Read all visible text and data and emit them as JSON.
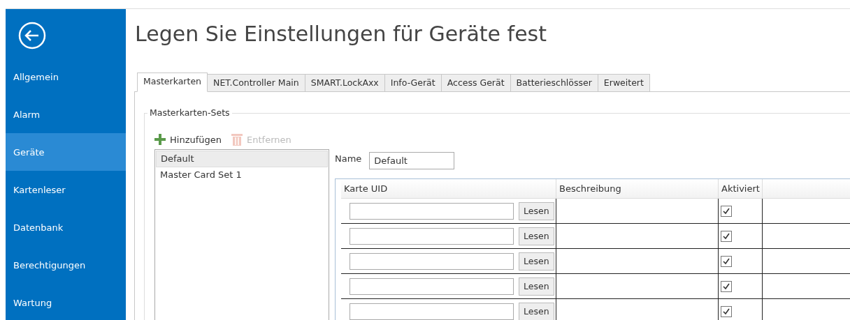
{
  "sidebar": {
    "items": [
      {
        "label": "Allgemein",
        "selected": false
      },
      {
        "label": "Alarm",
        "selected": false
      },
      {
        "label": "Geräte",
        "selected": true
      },
      {
        "label": "Kartenleser",
        "selected": false
      },
      {
        "label": "Datenbank",
        "selected": false
      },
      {
        "label": "Berechtigungen",
        "selected": false
      },
      {
        "label": "Wartung",
        "selected": false
      }
    ]
  },
  "title": "Legen Sie Einstellungen für Geräte fest",
  "tabs": [
    {
      "label": "Masterkarten",
      "selected": true
    },
    {
      "label": "NET.Controller Main",
      "selected": false
    },
    {
      "label": "SMART.LockAxx",
      "selected": false
    },
    {
      "label": "Info-Gerät",
      "selected": false
    },
    {
      "label": "Access Gerät",
      "selected": false
    },
    {
      "label": "Batterieschlösser",
      "selected": false
    },
    {
      "label": "Erweitert",
      "selected": false
    }
  ],
  "group_title": "Masterkarten-Sets",
  "toolbar": [
    {
      "label": "Hinzufügen",
      "kind": "add",
      "disabled": false
    },
    {
      "label": "Entfernen",
      "kind": "remove",
      "disabled": true
    }
  ],
  "sets": [
    {
      "label": "Default",
      "selected": true
    },
    {
      "label": "Master Card Set 1",
      "selected": false
    }
  ],
  "name_field": {
    "label": "Name",
    "value": "Default"
  },
  "grid": {
    "columns": [
      "Karte UID",
      "Beschreibung",
      "Aktiviert"
    ],
    "rows": [
      {
        "button": "Lesen",
        "checked": true
      },
      {
        "button": "Lesen",
        "checked": true
      },
      {
        "button": "Lesen",
        "checked": true
      },
      {
        "button": "Lesen",
        "checked": true
      },
      {
        "button": "Lesen",
        "checked": true
      }
    ]
  }
}
